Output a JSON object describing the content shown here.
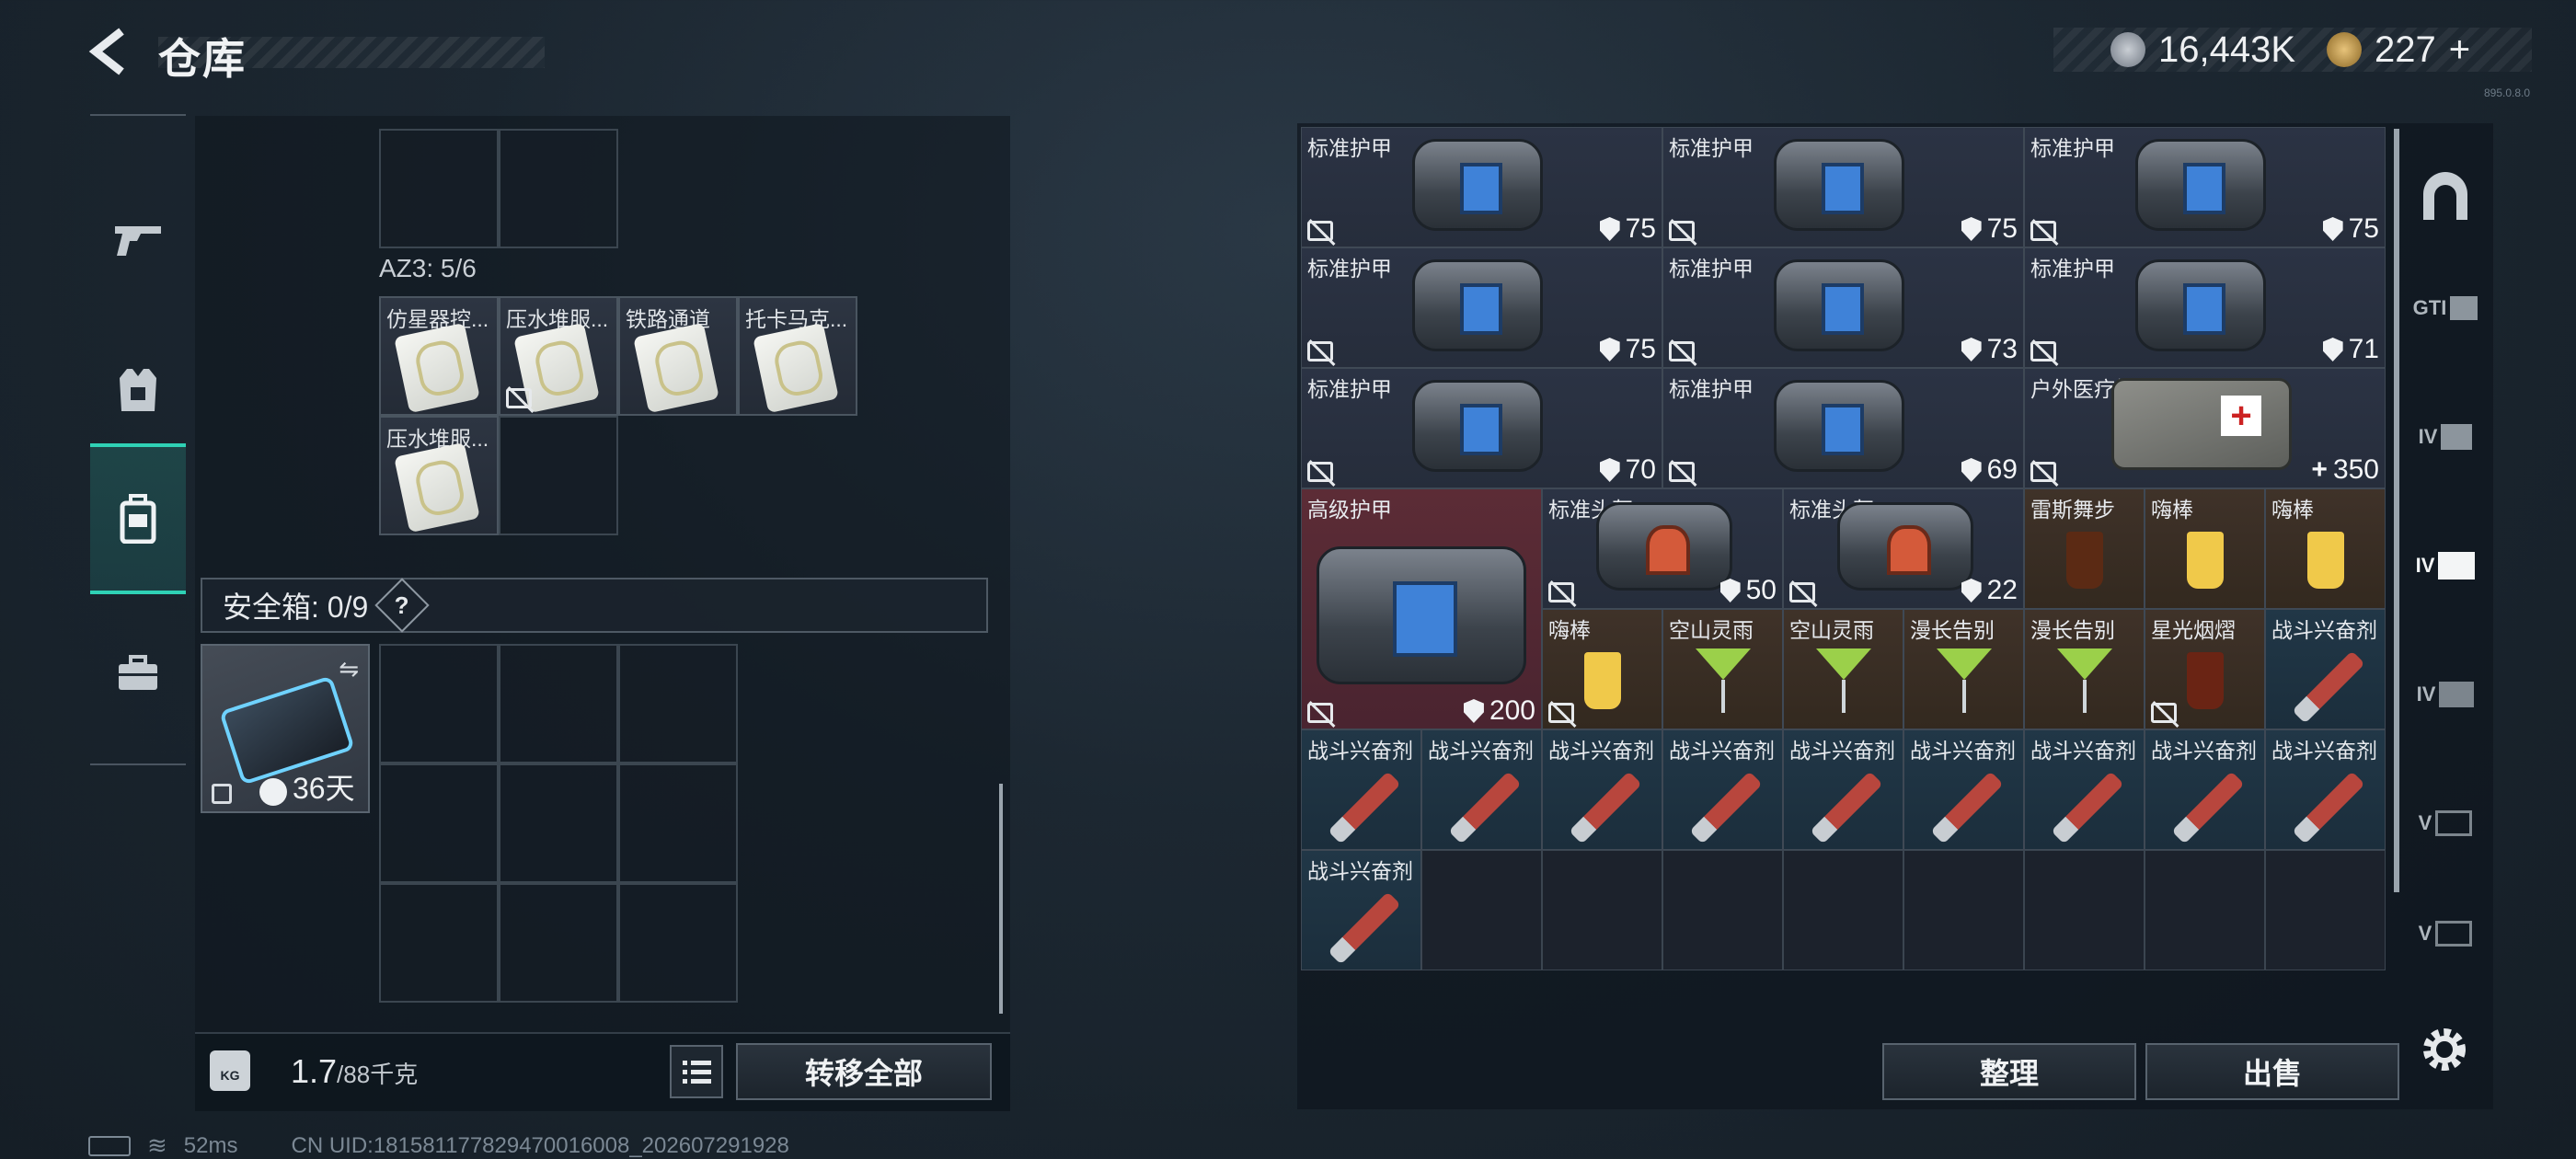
{
  "header": {
    "title": "仓库",
    "currency_1": "16,443K",
    "currency_2": "227",
    "currency_2_plus": "+",
    "version": "895.0.8.0"
  },
  "left": {
    "az3_label": "AZ3: 5/6",
    "az3_items": [
      "仿星器控...",
      "压水堆服...",
      "铁路通道",
      "托卡马克...",
      "压水堆服..."
    ],
    "safe_label": "安全箱: 0/9",
    "help": "?",
    "safebox_days": "36天",
    "weight": "1.7",
    "weight_cap": "/88千克",
    "kg_icon": "KG",
    "transfer_all": "转移全部"
  },
  "right": {
    "armor_label": "标准护甲",
    "armor_values": [
      "75",
      "75",
      "75",
      "75",
      "73",
      "71",
      "70",
      "69"
    ],
    "medkit_label": "户外医疗箱",
    "medkit_value": "350",
    "adv_armor_label": "高级护甲",
    "adv_armor_value": "200",
    "helmet_label": "标准头盔",
    "helmet_values": [
      "50",
      "22"
    ],
    "drinks": [
      "雷斯舞步",
      "嗨棒",
      "嗨棒",
      "嗨棒",
      "空山灵雨",
      "空山灵雨",
      "漫长告别",
      "漫长告别",
      "星光烟熠"
    ],
    "stim_label": "战斗兴奋剂",
    "sort": "整理",
    "sell": "出售",
    "nav": [
      "",
      "GTI",
      "IV",
      "IV",
      "IV",
      "V",
      "V"
    ]
  },
  "status": {
    "ping": "52ms",
    "uid": "CN UID:1815811778294700160​08_202607291928"
  },
  "colors": {
    "accent": "#2fd1b5",
    "adv_bg": "#5a2a33",
    "drink_bg": "#3d3128",
    "stim_bg": "#1f3444"
  }
}
